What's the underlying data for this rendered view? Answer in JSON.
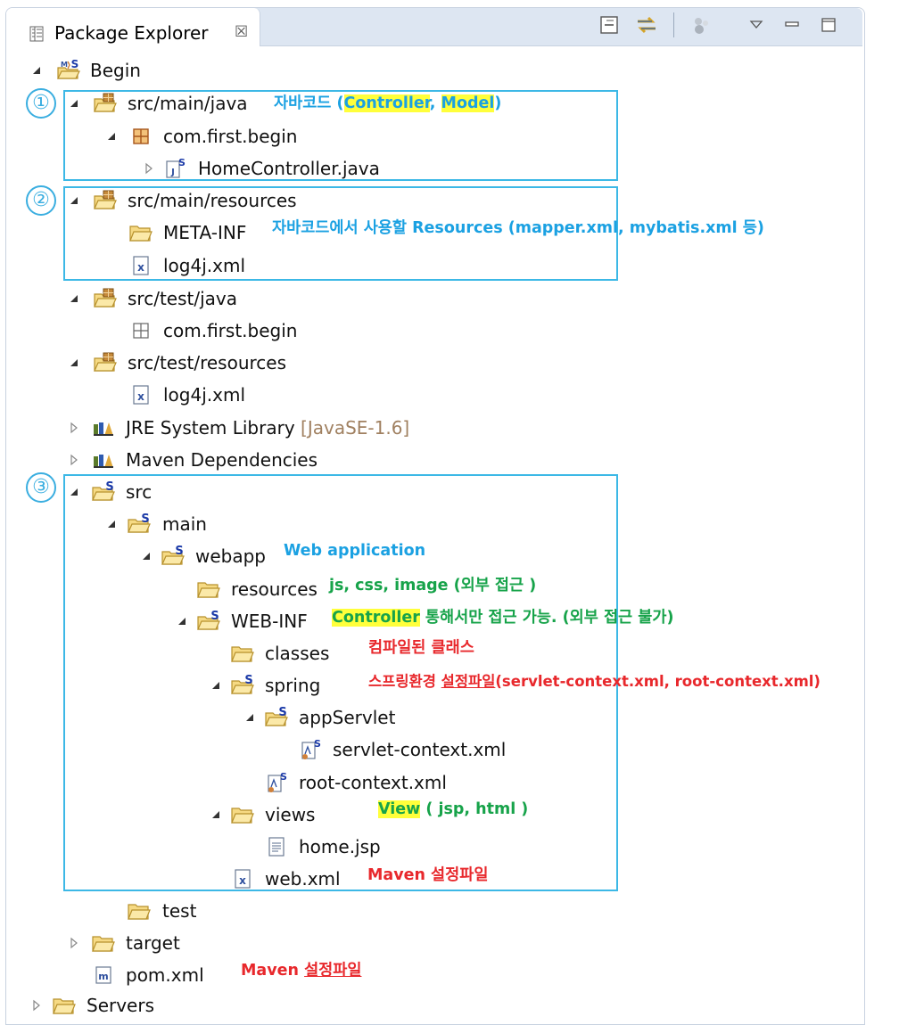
{
  "view": {
    "title": "Package Explorer",
    "close_glyph": "☒"
  },
  "tree": {
    "project": "Begin",
    "src_main_java": "src/main/java",
    "pkg_main": "com.first.begin",
    "home_controller": "HomeController.java",
    "src_main_resources": "src/main/resources",
    "meta_inf": "META-INF",
    "log4j_main": "log4j.xml",
    "src_test_java": "src/test/java",
    "pkg_test": "com.first.begin",
    "src_test_resources": "src/test/resources",
    "log4j_test": "log4j.xml",
    "jre_library": "JRE System Library",
    "jre_version": "[JavaSE-1.6]",
    "maven_deps": "Maven Dependencies",
    "src": "src",
    "main": "main",
    "webapp": "webapp",
    "resources": "resources",
    "web_inf": "WEB-INF",
    "classes": "classes",
    "spring": "spring",
    "app_servlet": "appServlet",
    "servlet_context": "servlet-context.xml",
    "root_context": "root-context.xml",
    "views": "views",
    "home_jsp": "home.jsp",
    "web_xml": "web.xml",
    "test": "test",
    "target": "target",
    "pom": "pom.xml",
    "servers": "Servers"
  },
  "annotations": {
    "markers": [
      "①",
      "②",
      "③"
    ],
    "a1_prefix": "자바코드 (",
    "a1_controller": "Controller",
    "a1_sep": ", ",
    "a1_model": "Model",
    "a1_suffix": ")",
    "a2": "자바코드에서 사용할 Resources (mapper.xml, mybatis.xml 등)",
    "a3": "Web application",
    "a4": "js, css, image (외부 접근 )",
    "a5_controller": "Controller",
    "a5_rest": " 통해서만 접근 가능. (외부 접근 불가)",
    "a6": "컴파일된 클래스",
    "a7_prefix": "스프링환경 ",
    "a7_underlined": "설정파일",
    "a7_suffix": "(servlet-context.xml, root-context.xml)",
    "a8_view": "View",
    "a8_rest": " ( jsp, html )",
    "a9": "Maven 설정파일",
    "a10_prefix": "Maven ",
    "a10_underlined": "설정파일"
  },
  "colors": {
    "accent_box": "#3cb8e6",
    "annotation_blue": "#1ba1e2",
    "annotation_green": "#17a34a",
    "annotation_red": "#e8282c",
    "highlight": "#ffff3b",
    "header_bg": "#dde6f2"
  }
}
